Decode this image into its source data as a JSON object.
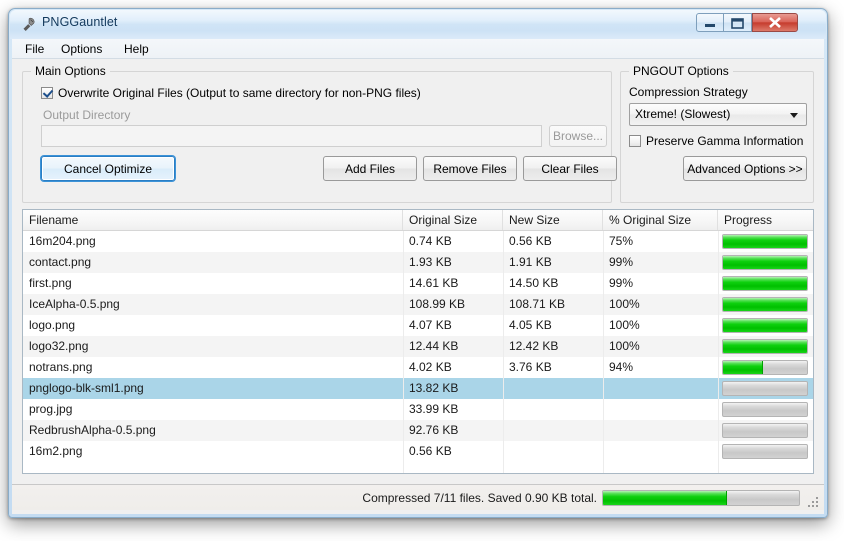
{
  "window": {
    "title": "PNGGauntlet",
    "icon": "gauntlet-icon",
    "buttons": {
      "minimize": "minimize-icon",
      "maximize": "maximize-icon",
      "close": "close-icon"
    }
  },
  "menubar": {
    "items": [
      {
        "label": "File"
      },
      {
        "label": "Options"
      },
      {
        "label": "Help"
      }
    ]
  },
  "main_options": {
    "legend": "Main Options",
    "overwrite_checkbox": {
      "label": "Overwrite Original Files (Output to same directory for non-PNG files)",
      "checked": true
    },
    "output_directory": {
      "label": "Output Directory",
      "value": "",
      "placeholder": "",
      "enabled": false
    },
    "browse_button": {
      "label": "Browse...",
      "enabled": false
    },
    "cancel_button": {
      "label": "Cancel Optimize",
      "focused": true
    },
    "add_files_button": {
      "label": "Add Files"
    },
    "remove_files_button": {
      "label": "Remove Files"
    },
    "clear_files_button": {
      "label": "Clear Files"
    }
  },
  "pngout_options": {
    "legend": "PNGOUT Options",
    "compression_strategy": {
      "label": "Compression Strategy",
      "selected": "Xtreme! (Slowest)"
    },
    "preserve_gamma": {
      "label": "Preserve Gamma Information",
      "checked": false
    },
    "advanced_button": {
      "label": "Advanced Options >>"
    }
  },
  "file_table": {
    "columns": [
      {
        "key": "filename",
        "label": "Filename"
      },
      {
        "key": "original_size",
        "label": "Original Size"
      },
      {
        "key": "new_size",
        "label": "New Size"
      },
      {
        "key": "percent",
        "label": "% Original Size"
      },
      {
        "key": "progress",
        "label": "Progress"
      }
    ],
    "rows": [
      {
        "filename": "16m204.png",
        "original_size": "0.74 KB",
        "new_size": "0.56 KB",
        "percent": "75%",
        "progress": 100,
        "selected": false
      },
      {
        "filename": "contact.png",
        "original_size": "1.93 KB",
        "new_size": "1.91 KB",
        "percent": "99%",
        "progress": 100,
        "selected": false
      },
      {
        "filename": "first.png",
        "original_size": "14.61 KB",
        "new_size": "14.50 KB",
        "percent": "99%",
        "progress": 100,
        "selected": false
      },
      {
        "filename": "IceAlpha-0.5.png",
        "original_size": "108.99 KB",
        "new_size": "108.71 KB",
        "percent": "100%",
        "progress": 100,
        "selected": false
      },
      {
        "filename": "logo.png",
        "original_size": "4.07 KB",
        "new_size": "4.05 KB",
        "percent": "100%",
        "progress": 100,
        "selected": false
      },
      {
        "filename": "logo32.png",
        "original_size": "12.44 KB",
        "new_size": "12.42 KB",
        "percent": "100%",
        "progress": 100,
        "selected": false
      },
      {
        "filename": "notrans.png",
        "original_size": "4.02 KB",
        "new_size": "3.76 KB",
        "percent": "94%",
        "progress": 47,
        "selected": false
      },
      {
        "filename": "pnglogo-blk-sml1.png",
        "original_size": "13.82 KB",
        "new_size": "",
        "percent": "",
        "progress": 0,
        "selected": true
      },
      {
        "filename": "prog.jpg",
        "original_size": "33.99 KB",
        "new_size": "",
        "percent": "",
        "progress": 0,
        "selected": false
      },
      {
        "filename": "RedbrushAlpha-0.5.png",
        "original_size": "92.76 KB",
        "new_size": "",
        "percent": "",
        "progress": 0,
        "selected": false
      },
      {
        "filename": "16m2.png",
        "original_size": "0.56 KB",
        "new_size": "",
        "percent": "",
        "progress": 0,
        "selected": false
      }
    ]
  },
  "statusbar": {
    "text": "Compressed 7/11 files. Saved 0.90 KB total.",
    "progress": 63,
    "grip": "resize-grip-icon"
  },
  "colors": {
    "accent": "#2a7ec4",
    "selection": "#aad5e8",
    "progress_green": "#00c000",
    "titlebar": "#d0e4f6",
    "close_red": "#c63c2e"
  }
}
